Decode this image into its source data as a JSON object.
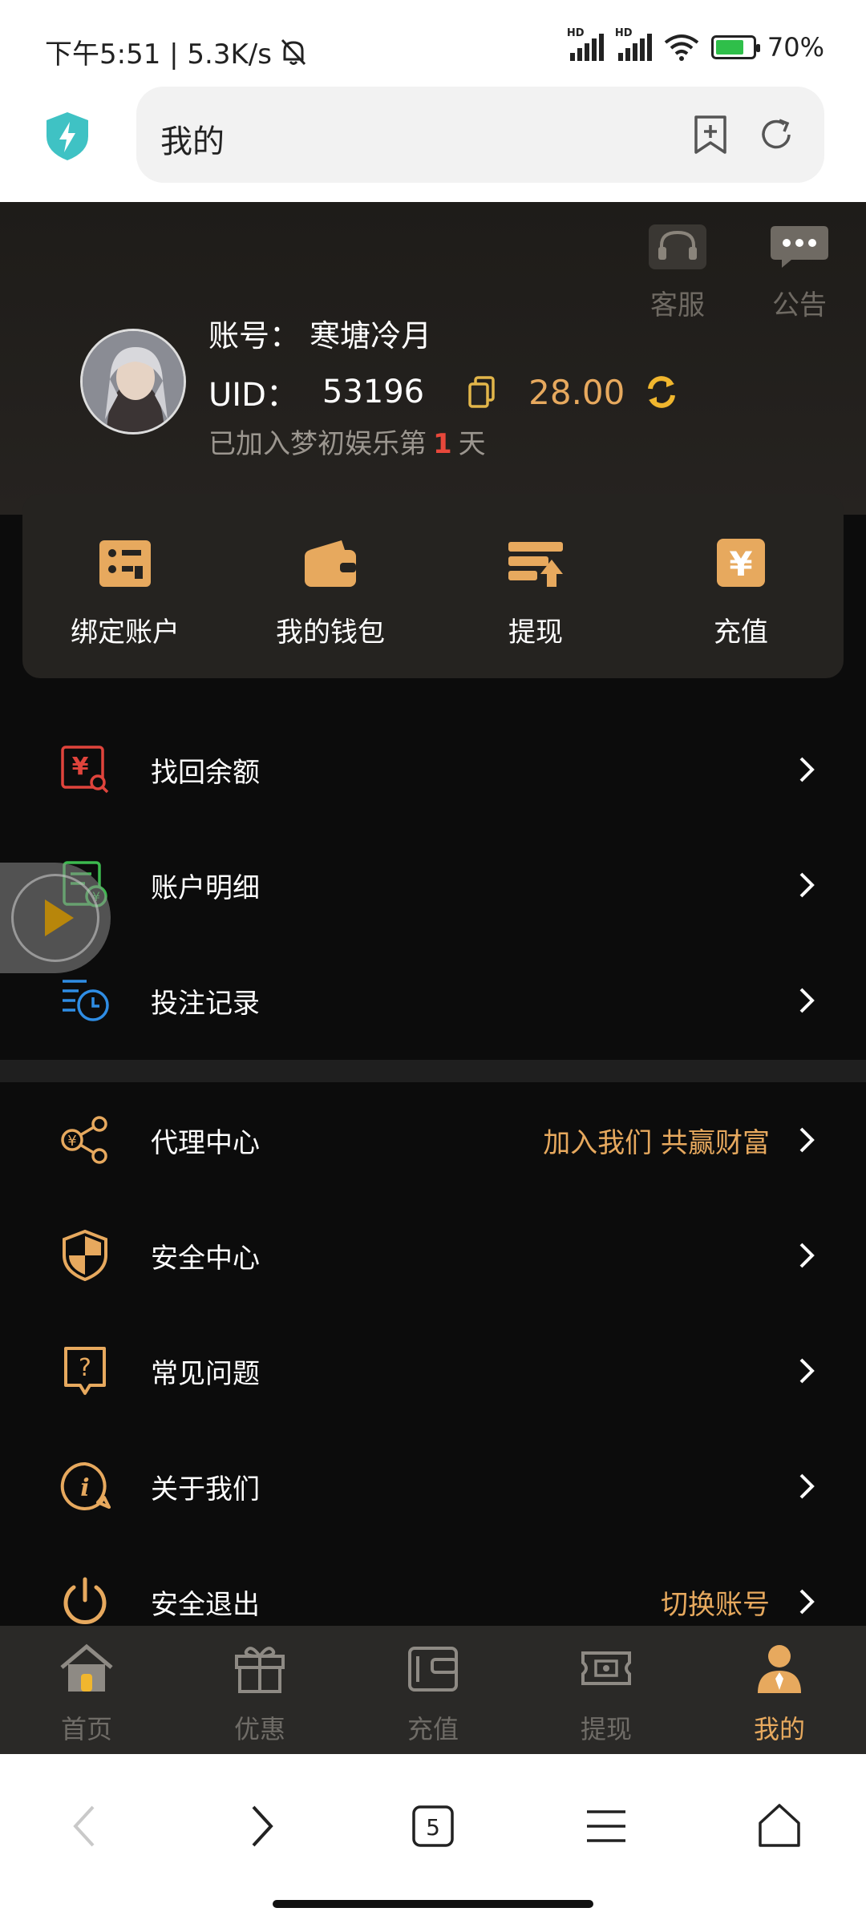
{
  "status_bar": {
    "time_speed": "下午5:51 | 5.3K/s",
    "hd1": "HD",
    "hd2": "HD",
    "battery": "70%"
  },
  "browser": {
    "address": "我的",
    "tabs_count": "5"
  },
  "header": {
    "service_label": "客服",
    "notice_label": "公告"
  },
  "profile": {
    "account_label": "账号：",
    "account_name": "寒塘冷月",
    "uid_label": "UID：",
    "uid_value": "53196",
    "balance": "28.00",
    "joined_prefix": "已加入梦初娱乐第",
    "joined_days": "1",
    "joined_suffix": "天"
  },
  "quick_actions": [
    {
      "label": "绑定账户",
      "icon": "card-icon"
    },
    {
      "label": "我的钱包",
      "icon": "wallet-icon"
    },
    {
      "label": "提现",
      "icon": "withdraw-icon"
    },
    {
      "label": "充值",
      "icon": "yuan-icon"
    }
  ],
  "menu_group1": [
    {
      "label": "找回余额",
      "icon": "yuan-search-icon"
    },
    {
      "label": "账户明细",
      "icon": "ledger-icon"
    },
    {
      "label": "投注记录",
      "icon": "record-clock-icon"
    }
  ],
  "menu_group2": [
    {
      "label": "代理中心",
      "extra": "加入我们 共赢财富",
      "icon": "share-icon"
    },
    {
      "label": "安全中心",
      "extra": "",
      "icon": "shield-icon"
    },
    {
      "label": "常见问题",
      "extra": "",
      "icon": "question-icon"
    },
    {
      "label": "关于我们",
      "extra": "",
      "icon": "info-icon"
    },
    {
      "label": "安全退出",
      "extra": "切换账号",
      "icon": "power-icon"
    }
  ],
  "tabbar": [
    {
      "label": "首页",
      "icon": "home-icon"
    },
    {
      "label": "优惠",
      "icon": "gift-icon"
    },
    {
      "label": "充值",
      "icon": "wallet-icon"
    },
    {
      "label": "提现",
      "icon": "ticket-icon"
    },
    {
      "label": "我的",
      "icon": "user-icon",
      "active": true
    }
  ],
  "colors": {
    "accent": "#e7a95e",
    "background": "#0c0c0c",
    "card": "#252320",
    "highlight_red": "#e8483b"
  }
}
